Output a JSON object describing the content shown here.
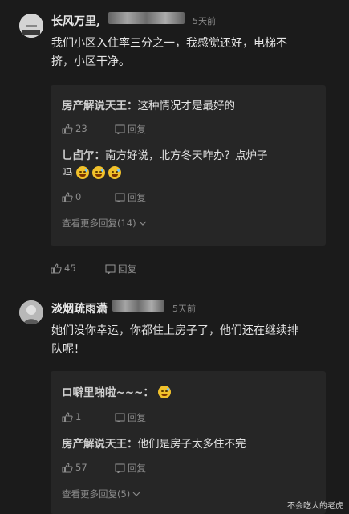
{
  "comment1": {
    "username": "长风万里,",
    "time": "5天前",
    "text_line1": "我们小区入住率三分之一，我感觉还好，电梯不",
    "text_line2": "挤，小区干净。",
    "likes": "45",
    "reply_label": "回复",
    "replies": [
      {
        "name": "房产解说天王：",
        "text": "这种情况才是最好的",
        "likes": "23",
        "reply_label": "回复"
      },
      {
        "name": "乚卣亇：",
        "text_line1": "南方好说，北方冬天咋办？点炉子",
        "text_line2": "吗",
        "likes": "0",
        "reply_label": "回复"
      }
    ],
    "more_replies": "查看更多回复(14)"
  },
  "comment2": {
    "username": "淡烟疏雨潇",
    "time": "5天前",
    "text_line1": "她们没你幸运，你都住上房子了，他们还在继续排",
    "text_line2": "队呢！",
    "replies": [
      {
        "name": "ロ噼里啪啦~~~：",
        "likes": "1",
        "reply_label": "回复"
      },
      {
        "name": "房产解说天王：",
        "text": "他们是房子太多住不完",
        "likes": "57",
        "reply_label": "回复"
      }
    ],
    "more_replies": "查看更多回复(5)"
  },
  "watermark": "不会吃人的老虎",
  "icons": [
    "thumb-up-icon",
    "comment-icon",
    "chevron-down-icon",
    "grin-sweat-emoji",
    "laugh-emoji"
  ]
}
